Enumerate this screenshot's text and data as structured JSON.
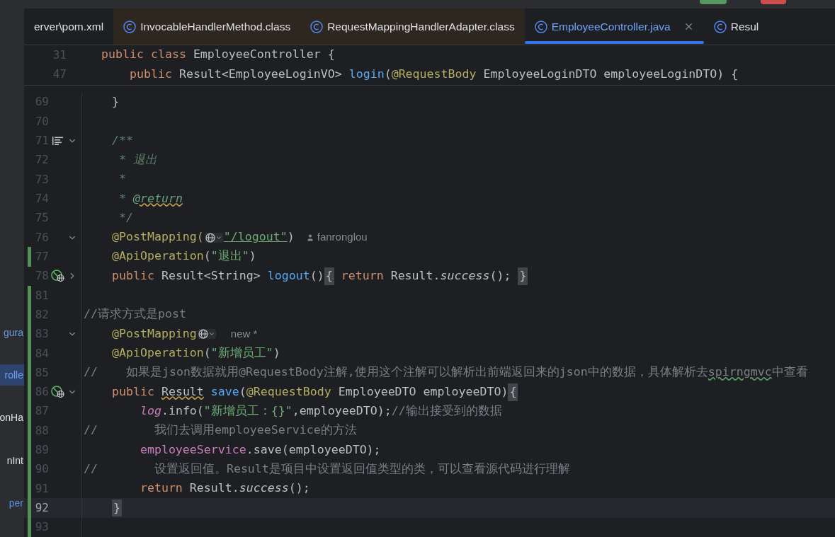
{
  "project_panel": {
    "items": [
      {
        "text": "gura",
        "selected": false,
        "color": "#6e9be0"
      },
      {
        "text": "rolle",
        "selected": true,
        "color": "#6ea1f0"
      },
      {
        "text": "onHa",
        "selected": false,
        "color": "#dfe1e5"
      },
      {
        "text": "nInt",
        "selected": false,
        "color": "#dfe1e5"
      },
      {
        "text": "per",
        "selected": false,
        "color": "#5a93e6"
      }
    ]
  },
  "tabs": [
    {
      "label": "erver\\pom.xml",
      "kind": "file",
      "selected": false
    },
    {
      "label": "InvocableHandlerMethod.class",
      "kind": "library",
      "selected": false
    },
    {
      "label": "RequestMappingHandlerAdapter.class",
      "kind": "library",
      "selected": false
    },
    {
      "label": "EmployeeController.java",
      "kind": "source",
      "selected": true
    },
    {
      "label": "Resul",
      "kind": "source",
      "selected": false
    }
  ],
  "sticky_lines": [
    {
      "number": "31",
      "tokens": [
        {
          "kind": "keyword",
          "text": "public class "
        },
        {
          "kind": "plain",
          "text": "EmployeeController {"
        }
      ]
    },
    {
      "number": "47",
      "tokens": [
        {
          "kind": "keyword",
          "text": "    public "
        },
        {
          "kind": "plain",
          "text": "Result<EmployeeLoginVO> "
        },
        {
          "kind": "method",
          "text": "login"
        },
        {
          "kind": "plain",
          "text": "("
        },
        {
          "kind": "annotation",
          "text": "@RequestBody"
        },
        {
          "kind": "plain",
          "text": " EmployeeLoginDTO employeeLoginDTO) {"
        }
      ]
    }
  ],
  "lines": [
    {
      "number": "69",
      "changed": false,
      "current": false,
      "tokens": [
        {
          "kind": "plain",
          "text": "    }"
        }
      ]
    },
    {
      "number": "70",
      "changed": false,
      "current": false
    },
    {
      "number": "71",
      "changed": false,
      "current": false,
      "gutter_icon": {
        "kind": "doc"
      },
      "fold_marker": {
        "expanded": true
      },
      "tokens": [
        {
          "kind": "doc",
          "text": "    /**"
        }
      ]
    },
    {
      "number": "72",
      "changed": false,
      "current": false,
      "tokens": [
        {
          "kind": "doc",
          "text": "     * 退出"
        }
      ]
    },
    {
      "number": "73",
      "changed": false,
      "current": false,
      "tokens": [
        {
          "kind": "doc",
          "text": "     *"
        }
      ]
    },
    {
      "number": "74",
      "changed": false,
      "current": false,
      "tokens": [
        {
          "kind": "doc",
          "text": "     * "
        },
        {
          "kind": "doctag",
          "text": "@return"
        }
      ]
    },
    {
      "number": "75",
      "changed": false,
      "current": false,
      "tokens": [
        {
          "kind": "doc",
          "text": "     */"
        }
      ]
    },
    {
      "number": "76",
      "changed": false,
      "current": false,
      "fold_marker": {
        "expanded": true
      },
      "tokens": [
        {
          "kind": "annotation",
          "text": "    @PostMapping("
        },
        {
          "kind": "globe"
        },
        {
          "kind": "link",
          "text": "\"/logout\""
        },
        {
          "kind": "plain",
          "text": ")"
        },
        {
          "kind": "author",
          "text": "fanronglou"
        }
      ]
    },
    {
      "number": "77",
      "changed": true,
      "current": false,
      "tokens": [
        {
          "kind": "annotation",
          "text": "    @ApiOperation"
        },
        {
          "kind": "plain",
          "text": "("
        },
        {
          "kind": "string",
          "text": "\"退出\""
        },
        {
          "kind": "plain",
          "text": ")"
        }
      ]
    },
    {
      "number": "78",
      "changed": false,
      "current": false,
      "gutter_icon": {
        "kind": "endpoint"
      },
      "fold_marker": {
        "expanded": false
      },
      "tokens": [
        {
          "kind": "keyword",
          "text": "    public "
        },
        {
          "kind": "plain",
          "text": "Result<String> "
        },
        {
          "kind": "method",
          "text": "logout"
        },
        {
          "kind": "plain",
          "text": "()"
        },
        {
          "kind": "brace",
          "text": "{"
        },
        {
          "kind": "keyword",
          "text": " return "
        },
        {
          "kind": "plain",
          "text": "Result."
        },
        {
          "kind": "static",
          "text": "success"
        },
        {
          "kind": "plain",
          "text": "(); "
        },
        {
          "kind": "brace",
          "text": "}"
        }
      ]
    },
    {
      "number": "81",
      "changed": true,
      "current": false
    },
    {
      "number": "82",
      "changed": true,
      "current": false,
      "tokens": [
        {
          "kind": "comment",
          "text": "//请求方式是post"
        }
      ]
    },
    {
      "number": "83",
      "changed": true,
      "current": false,
      "fold_marker": {
        "expanded": true
      },
      "tokens": [
        {
          "kind": "annotation",
          "text": "    @PostMapping"
        },
        {
          "kind": "globe"
        },
        {
          "kind": "hint",
          "text": "new *"
        }
      ]
    },
    {
      "number": "84",
      "changed": true,
      "current": false,
      "tokens": [
        {
          "kind": "annotation",
          "text": "    @ApiOperation"
        },
        {
          "kind": "plain",
          "text": "("
        },
        {
          "kind": "string",
          "text": "\"新增员工\""
        },
        {
          "kind": "plain",
          "text": ")"
        }
      ]
    },
    {
      "number": "85",
      "changed": true,
      "current": false,
      "tokens": [
        {
          "kind": "comment",
          "text": "//    如果是json数据就用@RequestBody注解,使用这个注解可以解析出前端返回来的json中的数据，具体解析去"
        },
        {
          "kind": "typo",
          "text": "spirngmvc"
        },
        {
          "kind": "comment",
          "text": "中查看"
        }
      ]
    },
    {
      "number": "86",
      "changed": true,
      "current": false,
      "gutter_icon": {
        "kind": "endpoint"
      },
      "fold_marker": {
        "expanded": true
      },
      "tokens": [
        {
          "kind": "keyword",
          "text": "    public "
        },
        {
          "kind": "warning",
          "text": "Result"
        },
        {
          "kind": "method",
          "text": " save"
        },
        {
          "kind": "plain",
          "text": "("
        },
        {
          "kind": "annotation",
          "text": "@RequestBody"
        },
        {
          "kind": "plain",
          "text": " EmployeeDTO employeeDTO)"
        },
        {
          "kind": "brace",
          "text": "{"
        }
      ]
    },
    {
      "number": "87",
      "changed": true,
      "current": false,
      "tokens": [
        {
          "kind": "static_field",
          "text": "        log"
        },
        {
          "kind": "plain",
          "text": ".info("
        },
        {
          "kind": "string",
          "text": "\"新增员工：{}\""
        },
        {
          "kind": "plain",
          "text": ",employeeDTO);"
        },
        {
          "kind": "comment",
          "text": "//输出接受到的数据"
        }
      ]
    },
    {
      "number": "88",
      "changed": true,
      "current": false,
      "tokens": [
        {
          "kind": "comment",
          "text": "//        我们去调用employeeService的方法"
        }
      ]
    },
    {
      "number": "89",
      "changed": true,
      "current": false,
      "tokens": [
        {
          "kind": "field",
          "text": "        employeeService"
        },
        {
          "kind": "plain",
          "text": ".save(employeeDTO);"
        }
      ]
    },
    {
      "number": "90",
      "changed": true,
      "current": false,
      "tokens": [
        {
          "kind": "comment",
          "text": "//        设置返回值。Result是项目中设置返回值类型的类，可以查看源代码进行理解"
        }
      ]
    },
    {
      "number": "91",
      "changed": true,
      "current": false,
      "tokens": [
        {
          "kind": "keyword",
          "text": "        return "
        },
        {
          "kind": "plain",
          "text": "Result."
        },
        {
          "kind": "static",
          "text": "success"
        },
        {
          "kind": "plain",
          "text": "();"
        }
      ]
    },
    {
      "number": "92",
      "changed": true,
      "current": true,
      "tokens": [
        {
          "kind": "brace",
          "text": "    }"
        }
      ]
    },
    {
      "number": "93",
      "changed": true,
      "current": false
    }
  ]
}
